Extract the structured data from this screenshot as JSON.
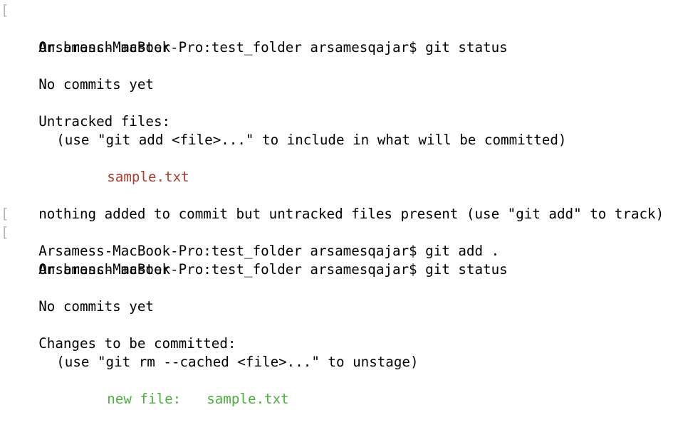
{
  "colors": {
    "background": "#ffffff",
    "text": "#000000",
    "untracked": "#b13a2c",
    "staged": "#4caf3e",
    "prompt_marker": "#b5b5b5"
  },
  "terminal": {
    "marker": "[",
    "block1": {
      "prompt": "Arsamess-MacBook-Pro:test_folder arsamesqajar$ git status",
      "branch": "On branch master",
      "commits": "No commits yet",
      "section": "Untracked files:",
      "hint": "(use \"git add <file>...\" to include in what will be committed)",
      "file": "sample.txt",
      "summary": "nothing added to commit but untracked files present (use \"git add\" to track)"
    },
    "prompt_add": "Arsamess-MacBook-Pro:test_folder arsamesqajar$ git add .",
    "block2": {
      "prompt": "Arsamess-MacBook-Pro:test_folder arsamesqajar$ git status",
      "branch": "On branch master",
      "commits": "No commits yet",
      "section": "Changes to be committed:",
      "hint": "(use \"git rm --cached <file>...\" to unstage)",
      "file_status": "new file:",
      "file": "sample.txt"
    }
  }
}
